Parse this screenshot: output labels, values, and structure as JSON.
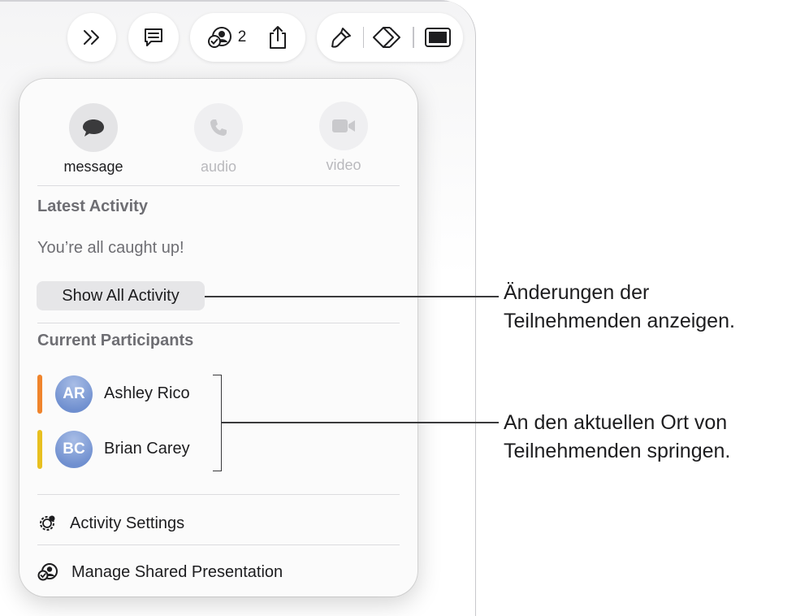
{
  "toolbar": {
    "more_icon": "double-chevron-icon",
    "comment_icon": "comment-icon",
    "collaboration_icon": "collaboration-icon",
    "collaborator_count": "2",
    "share_icon": "share-icon",
    "format_icon": "paintbrush-icon",
    "animate_icon": "diamond-icon",
    "document_icon": "document-pane-icon"
  },
  "popover": {
    "communication": [
      {
        "label": "message",
        "icon": "message-bubble-icon",
        "enabled": true
      },
      {
        "label": "audio",
        "icon": "phone-icon",
        "enabled": false
      },
      {
        "label": "video",
        "icon": "video-camera-icon",
        "enabled": false
      }
    ],
    "latest_activity": {
      "title": "Latest Activity",
      "status": "You’re all caught up!",
      "show_all_button": "Show All Activity"
    },
    "participants": {
      "title": "Current Participants",
      "items": [
        {
          "initials": "AR",
          "name": "Ashley Rico",
          "color": "#f0842c"
        },
        {
          "initials": "BC",
          "name": "Brian Carey",
          "color": "#e8c020"
        }
      ]
    },
    "menu": {
      "activity_settings": "Activity Settings",
      "manage_shared": "Manage Shared Presentation"
    }
  },
  "callouts": {
    "show_all": {
      "line1": "Änderungen der",
      "line2": "Teilnehmenden anzeigen."
    },
    "participants": {
      "line1": "An den aktuellen Ort von",
      "line2": "Teilnehmenden springen."
    }
  }
}
